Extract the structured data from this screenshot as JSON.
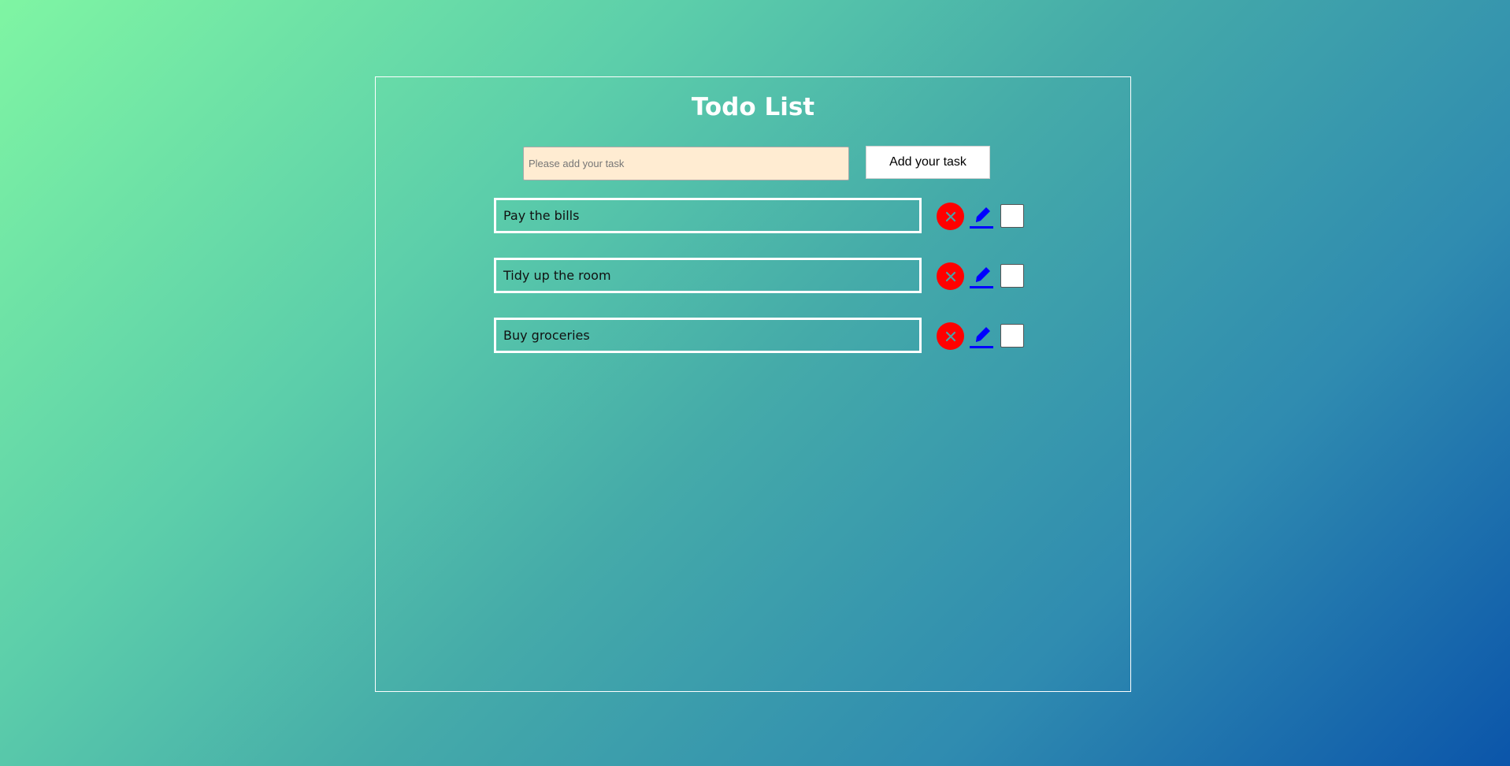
{
  "app": {
    "title": "Todo List"
  },
  "input": {
    "placeholder": "Please add your task",
    "value": ""
  },
  "add_button": {
    "label": "Add your task"
  },
  "todos": [
    {
      "text": "Pay the bills",
      "completed": false
    },
    {
      "text": "Tidy up the room",
      "completed": false
    },
    {
      "text": "Buy groceries",
      "completed": false
    }
  ],
  "icons": {
    "delete": "close-icon",
    "edit": "pencil-icon"
  },
  "colors": {
    "background_start": "#7ff5a3",
    "background_end": "#0b55aa",
    "delete": "#ff0000",
    "edit": "#0000ff",
    "input_background": "#ffecd2"
  }
}
